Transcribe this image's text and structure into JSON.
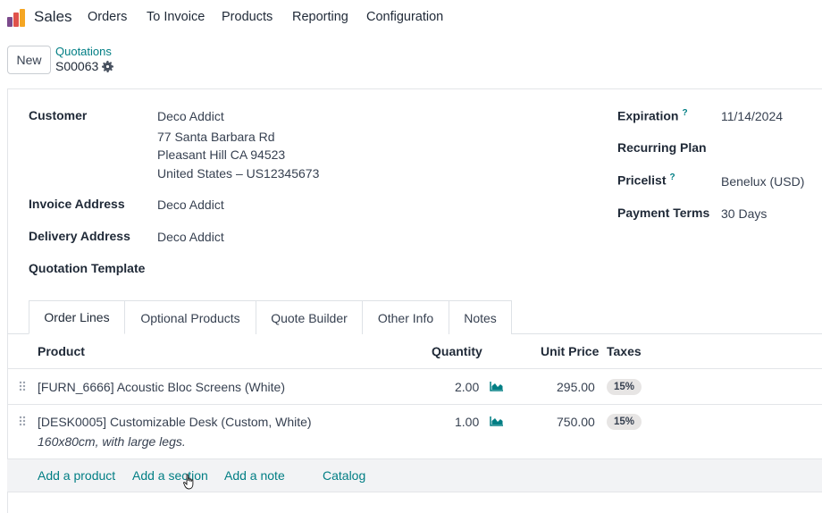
{
  "topnav": {
    "app_name": "Sales",
    "items": [
      "Orders",
      "To Invoice",
      "Products",
      "Reporting",
      "Configuration"
    ]
  },
  "control": {
    "new_label": "New",
    "breadcrumb_parent": "Quotations",
    "breadcrumb_current": "S00063"
  },
  "form": {
    "customer_label": "Customer",
    "customer_lines": [
      "Deco Addict",
      "77 Santa Barbara Rd",
      "Pleasant Hill CA 94523",
      "United States – US12345673"
    ],
    "invoice_address_label": "Invoice Address",
    "invoice_address_value": "Deco Addict",
    "delivery_address_label": "Delivery Address",
    "delivery_address_value": "Deco Addict",
    "quotation_template_label": "Quotation Template",
    "expiration_label": "Expiration",
    "expiration_value": "11/14/2024",
    "recurring_plan_label": "Recurring Plan",
    "pricelist_label": "Pricelist",
    "pricelist_value": "Benelux (USD)",
    "payment_terms_label": "Payment Terms",
    "payment_terms_value": "30 Days",
    "tooltip_mark": "?"
  },
  "tabs": [
    "Order Lines",
    "Optional Products",
    "Quote Builder",
    "Other Info",
    "Notes"
  ],
  "table": {
    "headers": {
      "product": "Product",
      "quantity": "Quantity",
      "unit_price": "Unit Price",
      "taxes": "Taxes"
    },
    "rows": [
      {
        "product": "[FURN_6666] Acoustic Bloc Screens (White)",
        "description": "",
        "quantity": "2.00",
        "unit_price": "295.00",
        "tax": "15%"
      },
      {
        "product": "[DESK0005] Customizable Desk (Custom, White)",
        "description": "160x80cm, with large legs.",
        "quantity": "1.00",
        "unit_price": "750.00",
        "tax": "15%"
      }
    ]
  },
  "add_line": {
    "add_product": "Add a product",
    "add_section": "Add a section",
    "add_note": "Add a note",
    "catalog": "Catalog"
  },
  "colors": {
    "accent": "#017e84",
    "badge_bg": "#e7e5e4",
    "logo_orange": "#f5a623",
    "logo_red": "#e0524a",
    "logo_purple": "#7c4a8c"
  },
  "icons": {
    "app_logo": "sales-logo-icon",
    "gear": "gear-icon",
    "handle": "drag-handle-icon",
    "forecast": "area-chart-icon"
  }
}
